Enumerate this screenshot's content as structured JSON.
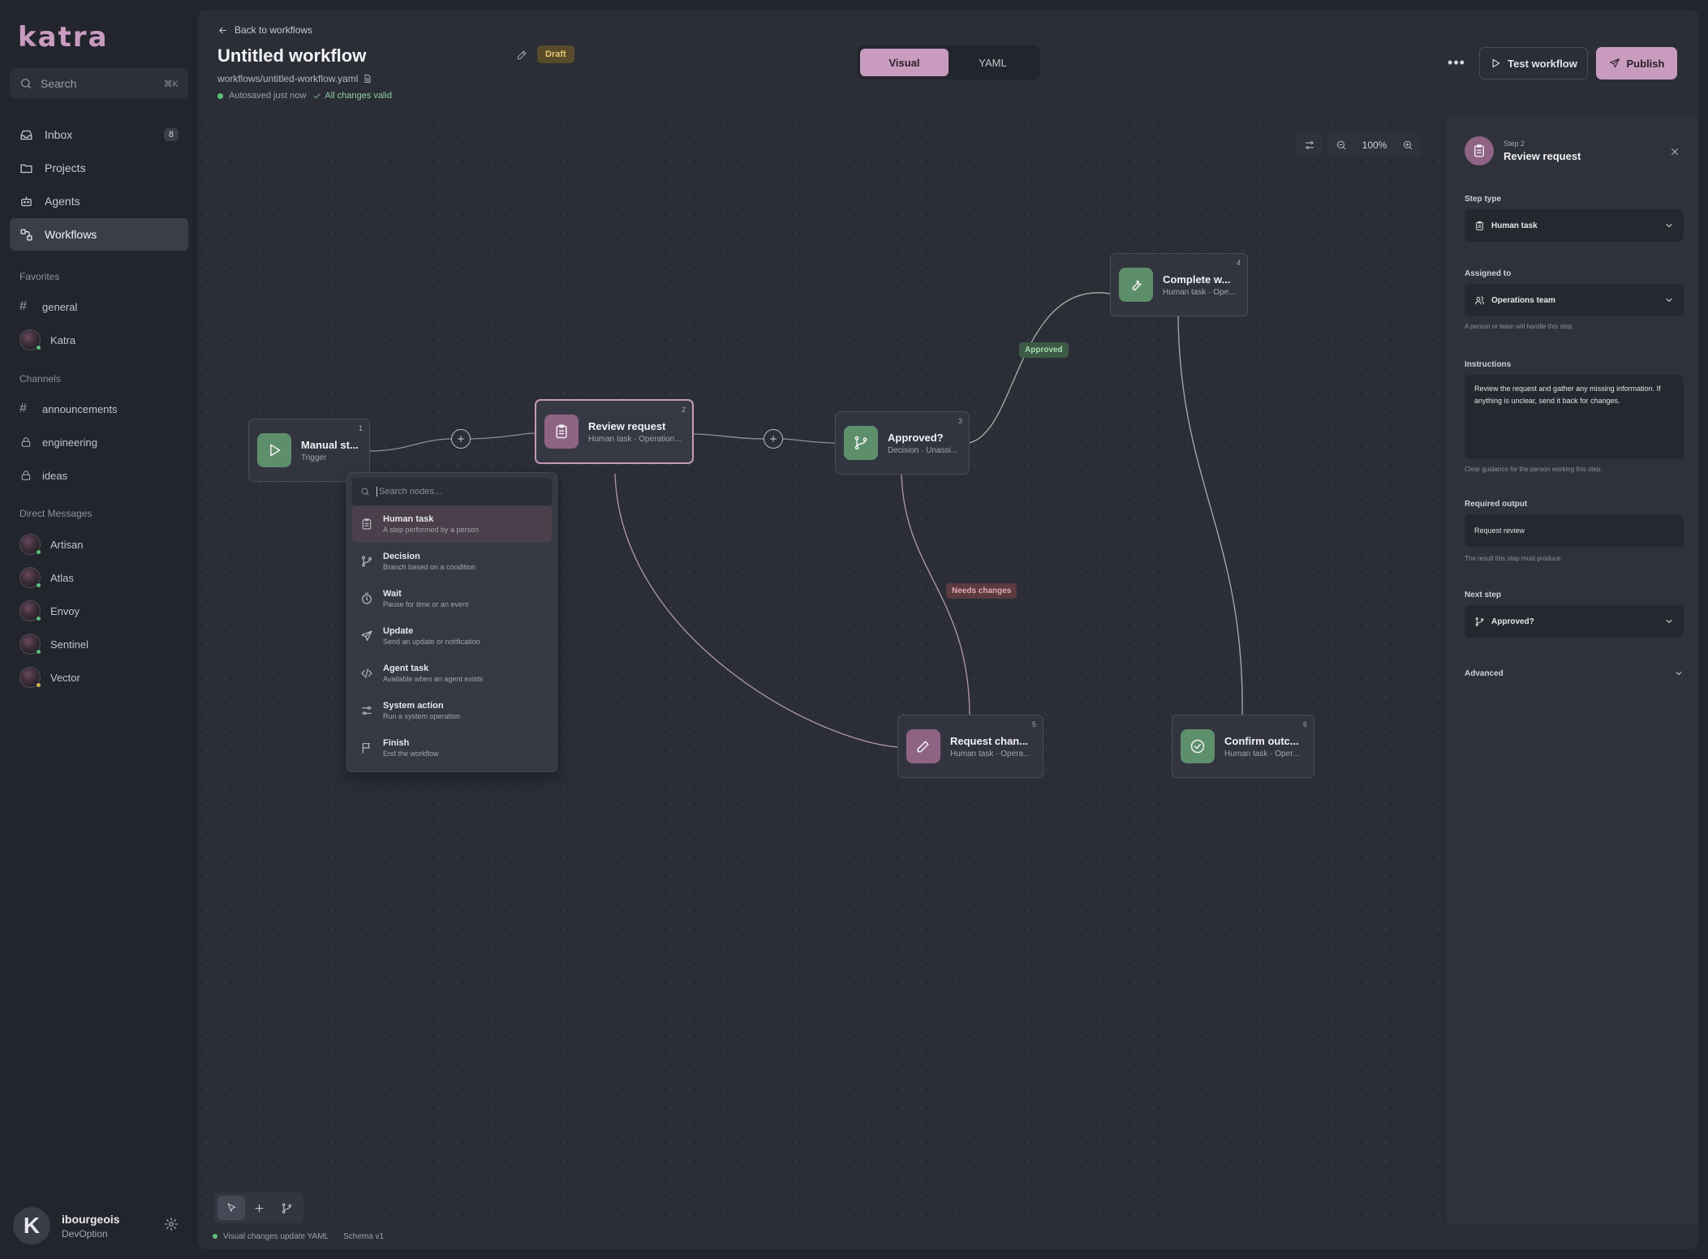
{
  "app": {
    "logo": "katra",
    "search": {
      "label": "Search",
      "shortcut": "⌘K"
    },
    "nav": [
      {
        "label": "Inbox",
        "badge": "8",
        "icon": "inbox-icon"
      },
      {
        "label": "Projects",
        "icon": "folder-icon"
      },
      {
        "label": "Agents",
        "icon": "bot-icon"
      },
      {
        "label": "Workflows",
        "icon": "workflow-icon",
        "active": true
      }
    ],
    "favorites_title": "Favorites",
    "favorites": [
      {
        "label": "general",
        "icon": "hash-icon"
      },
      {
        "label": "Katra",
        "icon": "avatar"
      }
    ],
    "channels_title": "Channels",
    "channels": [
      {
        "label": "announcements",
        "icon": "hash-icon"
      },
      {
        "label": "engineering",
        "icon": "lock-icon"
      },
      {
        "label": "ideas",
        "icon": "lock-icon"
      }
    ],
    "dm_title": "Direct Messages",
    "dms": [
      {
        "label": "Artisan"
      },
      {
        "label": "Atlas"
      },
      {
        "label": "Envoy"
      },
      {
        "label": "Sentinel"
      },
      {
        "label": "Vector"
      }
    ],
    "user": {
      "initial": "K",
      "name": "ibourgeois",
      "org": "DevOption"
    }
  },
  "header": {
    "back_label": "Back to workflows",
    "title": "Untitled workflow",
    "status_badge": "Draft",
    "file_path": "workflows/untitled-workflow.yaml",
    "autosave": "Autosaved just now",
    "validity": "All changes valid",
    "tabs": [
      "Visual",
      "YAML"
    ],
    "more_label": "•••",
    "test_label": "Test workflow",
    "publish_label": "Publish"
  },
  "canvas": {
    "zoom": "100%",
    "nodes": [
      {
        "num": "1",
        "title": "Manual st...",
        "sub": "Trigger",
        "icon": "play-icon",
        "color": "green"
      },
      {
        "num": "2",
        "title": "Review request",
        "sub": "Human task · Operation...",
        "icon": "clipboard-icon",
        "color": "pink",
        "selected": true
      },
      {
        "num": "3",
        "title": "Approved?",
        "sub": "Decision · Unassi...",
        "icon": "branch-icon",
        "color": "green"
      },
      {
        "num": "4",
        "title": "Complete w...",
        "sub": "Human task · Ope...",
        "icon": "wrench-icon",
        "color": "green"
      },
      {
        "num": "5",
        "title": "Request chan...",
        "sub": "Human task · Opera...",
        "icon": "pencil-icon",
        "color": "pink"
      },
      {
        "num": "6",
        "title": "Confirm outc...",
        "sub": "Human task · Oper...",
        "icon": "check-circle-icon",
        "color": "green"
      }
    ],
    "edge_labels": {
      "approved": "Approved",
      "needs_changes": "Needs changes"
    },
    "palette": {
      "placeholder": "Search nodes...",
      "items": [
        {
          "name": "Human task",
          "desc": "A step performed by a person",
          "icon": "clipboard-icon"
        },
        {
          "name": "Decision",
          "desc": "Branch based on a condition",
          "icon": "branch-icon"
        },
        {
          "name": "Wait",
          "desc": "Pause for time or an event",
          "icon": "timer-icon"
        },
        {
          "name": "Update",
          "desc": "Send an update or notification",
          "icon": "send-icon"
        },
        {
          "name": "Agent task",
          "desc": "Available when an agent exists",
          "icon": "code-icon"
        },
        {
          "name": "System action",
          "desc": "Run a system operation",
          "icon": "sliders-icon"
        },
        {
          "name": "Finish",
          "desc": "End the workflow",
          "icon": "flag-icon"
        }
      ]
    }
  },
  "footer": {
    "sync_status": "Visual changes update YAML",
    "schema": "Schema v1"
  },
  "inspector": {
    "step_label": "Step 2",
    "title": "Review request",
    "step_type_label": "Step type",
    "step_type_value": "Human task",
    "assigned_label": "Assigned to",
    "assigned_value": "Operations team",
    "assigned_help": "A person or team will handle this step.",
    "instructions_label": "Instructions",
    "instructions_value": "Review the request and gather any missing information. If anything is unclear, send it back for changes.",
    "instructions_help": "Clear guidance for the person working this step.",
    "output_label": "Required output",
    "output_value": "Request review",
    "output_help": "The result this step must produce.",
    "next_label": "Next step",
    "next_value": "Approved?",
    "advanced_label": "Advanced"
  }
}
